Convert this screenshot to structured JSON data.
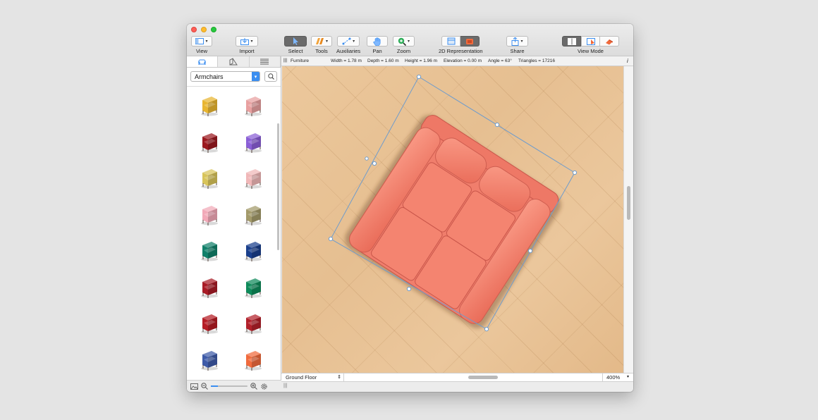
{
  "toolbar": {
    "view": "View",
    "import": "Import",
    "select": "Select",
    "tools": "Tools",
    "auxiliaries": "Auxiliaries",
    "pan": "Pan",
    "zoom": "Zoom",
    "representation": "2D Representation",
    "share": "Share",
    "view_mode": "View Mode"
  },
  "library": {
    "category": "Armchairs",
    "items": [
      {
        "icon": "armchair-yellow-icon",
        "color": "#e8b530"
      },
      {
        "icon": "armchair-pink-floral-icon",
        "color": "#e8a0a0"
      },
      {
        "icon": "armchair-dark-red-icon",
        "color": "#9c1a20"
      },
      {
        "icon": "armchair-purple-icon",
        "color": "#8a5fd6"
      },
      {
        "icon": "armchair-yellow-wood-icon",
        "color": "#d8c45a"
      },
      {
        "icon": "armchair-pink-metal-icon",
        "color": "#f0b7b8"
      },
      {
        "icon": "armchair-pink-icon",
        "color": "#f2a9b8"
      },
      {
        "icon": "armchair-olive-icon",
        "color": "#a39a6a"
      },
      {
        "icon": "armchair-teal-icon",
        "color": "#11806a"
      },
      {
        "icon": "armchair-navy-icon",
        "color": "#1a3f8c"
      },
      {
        "icon": "armchair-red-icon",
        "color": "#a81c26"
      },
      {
        "icon": "armchair-green-icon",
        "color": "#0e8a5a"
      },
      {
        "icon": "armchair-red-legs-icon",
        "color": "#b51c24"
      },
      {
        "icon": "armchair-red-modern-icon",
        "color": "#b2202a"
      },
      {
        "icon": "armchair-blue-pedestal-icon",
        "color": "#3d5aa8"
      },
      {
        "icon": "armchair-orange-pod-icon",
        "color": "#f06a3c"
      }
    ]
  },
  "info": {
    "label": "Furniture",
    "width": "Width = 1.78 m",
    "depth": "Depth = 1.60 m",
    "height": "Height = 1.96 m",
    "elevation": "Elevation = 0.00 m",
    "angle": "Angle = 63°",
    "triangles": "Triangles = 17216"
  },
  "status": {
    "floor": "Ground Floor",
    "zoom": "400%"
  },
  "colors": {
    "sofa": "#f07e6c",
    "floor": "#e6bf91",
    "selection": "#6f9ccc",
    "accent": "#3b8ef0"
  }
}
